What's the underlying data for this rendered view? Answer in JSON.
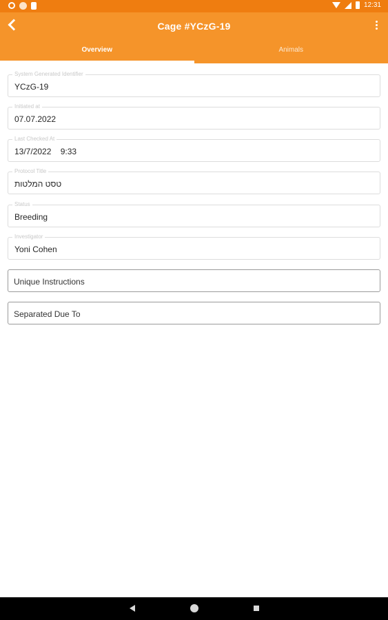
{
  "status_bar": {
    "time": "12:31",
    "left_icons": [
      "settings-icon",
      "notification-icon",
      "sd-card-icon"
    ],
    "right_icons": [
      "wifi-icon",
      "cell-signal-icon",
      "battery-icon"
    ]
  },
  "app_bar": {
    "title": "Cage #YCzG-19",
    "back_icon": "arrow-back-icon",
    "menu_icon": "more-vert-icon"
  },
  "tabs": [
    {
      "label": "Overview",
      "active": true
    },
    {
      "label": "Animals",
      "active": false
    }
  ],
  "fields": [
    {
      "label": "System Generated Identifier",
      "value": "YCzG-19"
    },
    {
      "label": "Initiated at",
      "value": "07.07.2022"
    },
    {
      "label": "Last Checked At",
      "value": "13/7/2022    9:33"
    },
    {
      "label": "Protocol Title",
      "value": "טסט המלטות"
    },
    {
      "label": "Status",
      "value": "Breeding"
    },
    {
      "label": "Investigator",
      "value": "Yoni Cohen"
    }
  ],
  "inputs": [
    {
      "placeholder": "Unique Instructions"
    },
    {
      "placeholder": "Separated Due To"
    }
  ],
  "colors": {
    "status_bar": "#ef7d10",
    "app_bar": "#f5942a",
    "tab_indicator": "#ffffff"
  },
  "nav_bar": {
    "icons": [
      "nav-back-icon",
      "nav-home-icon",
      "nav-recents-icon"
    ]
  }
}
